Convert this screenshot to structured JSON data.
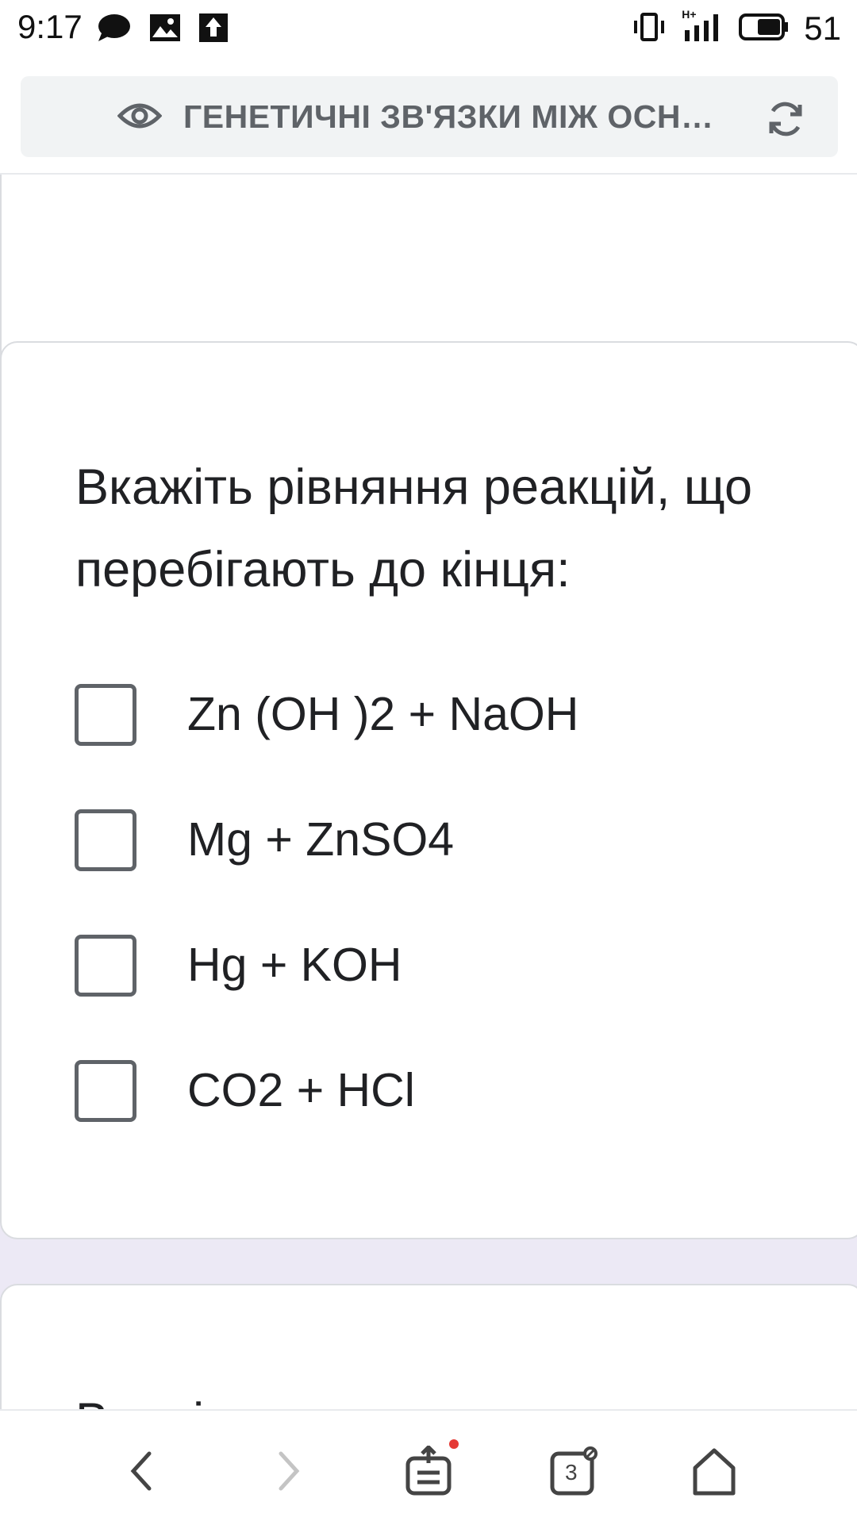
{
  "status_bar": {
    "time": "9:17",
    "left_icons": [
      "message-icon",
      "image-icon",
      "upload-icon"
    ],
    "right_icons": [
      "vibrate-icon",
      "signal-icon",
      "battery-icon"
    ],
    "network_type": "H+",
    "battery_level": "51"
  },
  "address_bar": {
    "page_title": "ГЕНЕТИЧНІ ЗВ'ЯЗКИ МІЖ ОСН…",
    "left_icon": "eye-icon",
    "right_icon": "refresh-icon"
  },
  "question": {
    "text_line1": "Вкажіть рівняння реакцій, що",
    "text_line2": "перебігають до кінця:",
    "options": [
      {
        "label": "Zn (OH )2 + NaOH",
        "checked": false
      },
      {
        "label": "Mg + ZnSO4",
        "checked": false
      },
      {
        "label": "Hg + KOH",
        "checked": false
      },
      {
        "label": "CO2 + HCl",
        "checked": false
      }
    ]
  },
  "next_question": {
    "text_partial": "Вкажіть загальну схему"
  },
  "bottom_nav": {
    "items": [
      "back-icon",
      "forward-icon",
      "share-icon",
      "tabs-icon",
      "home-icon"
    ],
    "tabs_count": "3"
  },
  "colors": {
    "page_background": "#ece9f5",
    "card_background": "#ffffff",
    "checkbox_border": "#5f6368",
    "badge": "#e53935"
  }
}
